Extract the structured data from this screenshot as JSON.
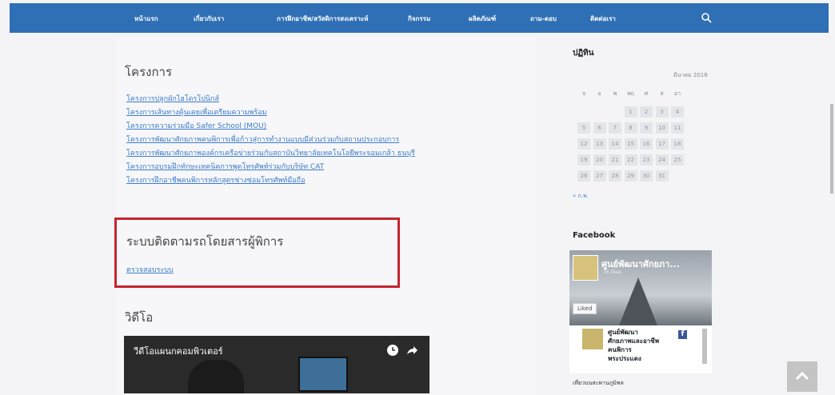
{
  "nav": {
    "items": [
      "หน้าแรก",
      "เกี่ยวกับเรา",
      "การฝึกอาชีพ/สวัสดิการสงเคราะห์",
      "กิจกรรม",
      "ผลิตภัณฑ์",
      "ถาม-ตอบ",
      "ติดต่อเรา"
    ],
    "search_icon": "search-icon"
  },
  "main": {
    "projects_title": "โครงการ",
    "projects": [
      "โครงการปลูกผักไฮโดรโปนิกส์",
      "โครงการเส้นทางคุ้นเคยเพื่อเตรียมความพร้อม",
      "โครงการความร่วมมือ Safer School (MOU)",
      "โครงการพัฒนาศักยภาพคนพิการเพื่อก้าวสู่การทำงานแบบมีส่วนร่วมกับสถานประกอบการ",
      "โครงการพัฒนาศักยภาพองค์กรเครือข่ายร่วมกับสถาบันวิทยาลัยเทคโนโลยีพระจอมเกล้า ธนบุรี",
      "โครงการอบรมฝึกทักษะเทคนิคการพูดโทรศัพท์ร่วมกับบริษัท CAT",
      "โครงการฝึกอาชีพคนพิการหลักสูตรช่างซ่อมโทรศัพท์มือถือ"
    ],
    "tracking_title": "ระบบติดตามรถโดยสารผู้พิการ",
    "tracking_link": "ตรวจสอบระบบ",
    "video_title": "วิดีโอ",
    "video_caption": "วีดีโอแผนกคอมพิวเตอร์"
  },
  "sidebar": {
    "calendar_title": "ปฏิทิน",
    "calendar_month": "มีนาคม 2018",
    "weekdays": [
      "จ",
      "อ",
      "พ",
      "พฤ",
      "ศ",
      "ส",
      "อา"
    ],
    "weeks": [
      [
        "",
        "",
        "",
        "1",
        "2",
        "3",
        "4"
      ],
      [
        "5",
        "6",
        "7",
        "8",
        "9",
        "10",
        "11"
      ],
      [
        "12",
        "13",
        "14",
        "15",
        "16",
        "17",
        "18"
      ],
      [
        "19",
        "20",
        "21",
        "22",
        "23",
        "24",
        "25"
      ],
      [
        "26",
        "27",
        "28",
        "29",
        "30",
        "31",
        ""
      ]
    ],
    "calendar_prev": "« ก.พ.",
    "facebook_title": "Facebook",
    "fb_page_name": "ศูนย์พัฒนาศักยภา...",
    "fb_likes": "1K likes",
    "fb_like_button": "Liked",
    "fb_post_name": "ศูนย์พัฒนา\nศักยภาพและอาชีพ\nคนพิการ\nพระประแดง",
    "fb_post_sub": "ศูนย์พัฒนาศักยภาพ",
    "fb_caption": "เที่ยวบนสะพานภูมิพล"
  },
  "colors": {
    "nav_bg": "#2f6fb5",
    "link": "#3c7bc9",
    "highlight_border": "#c6232f"
  }
}
